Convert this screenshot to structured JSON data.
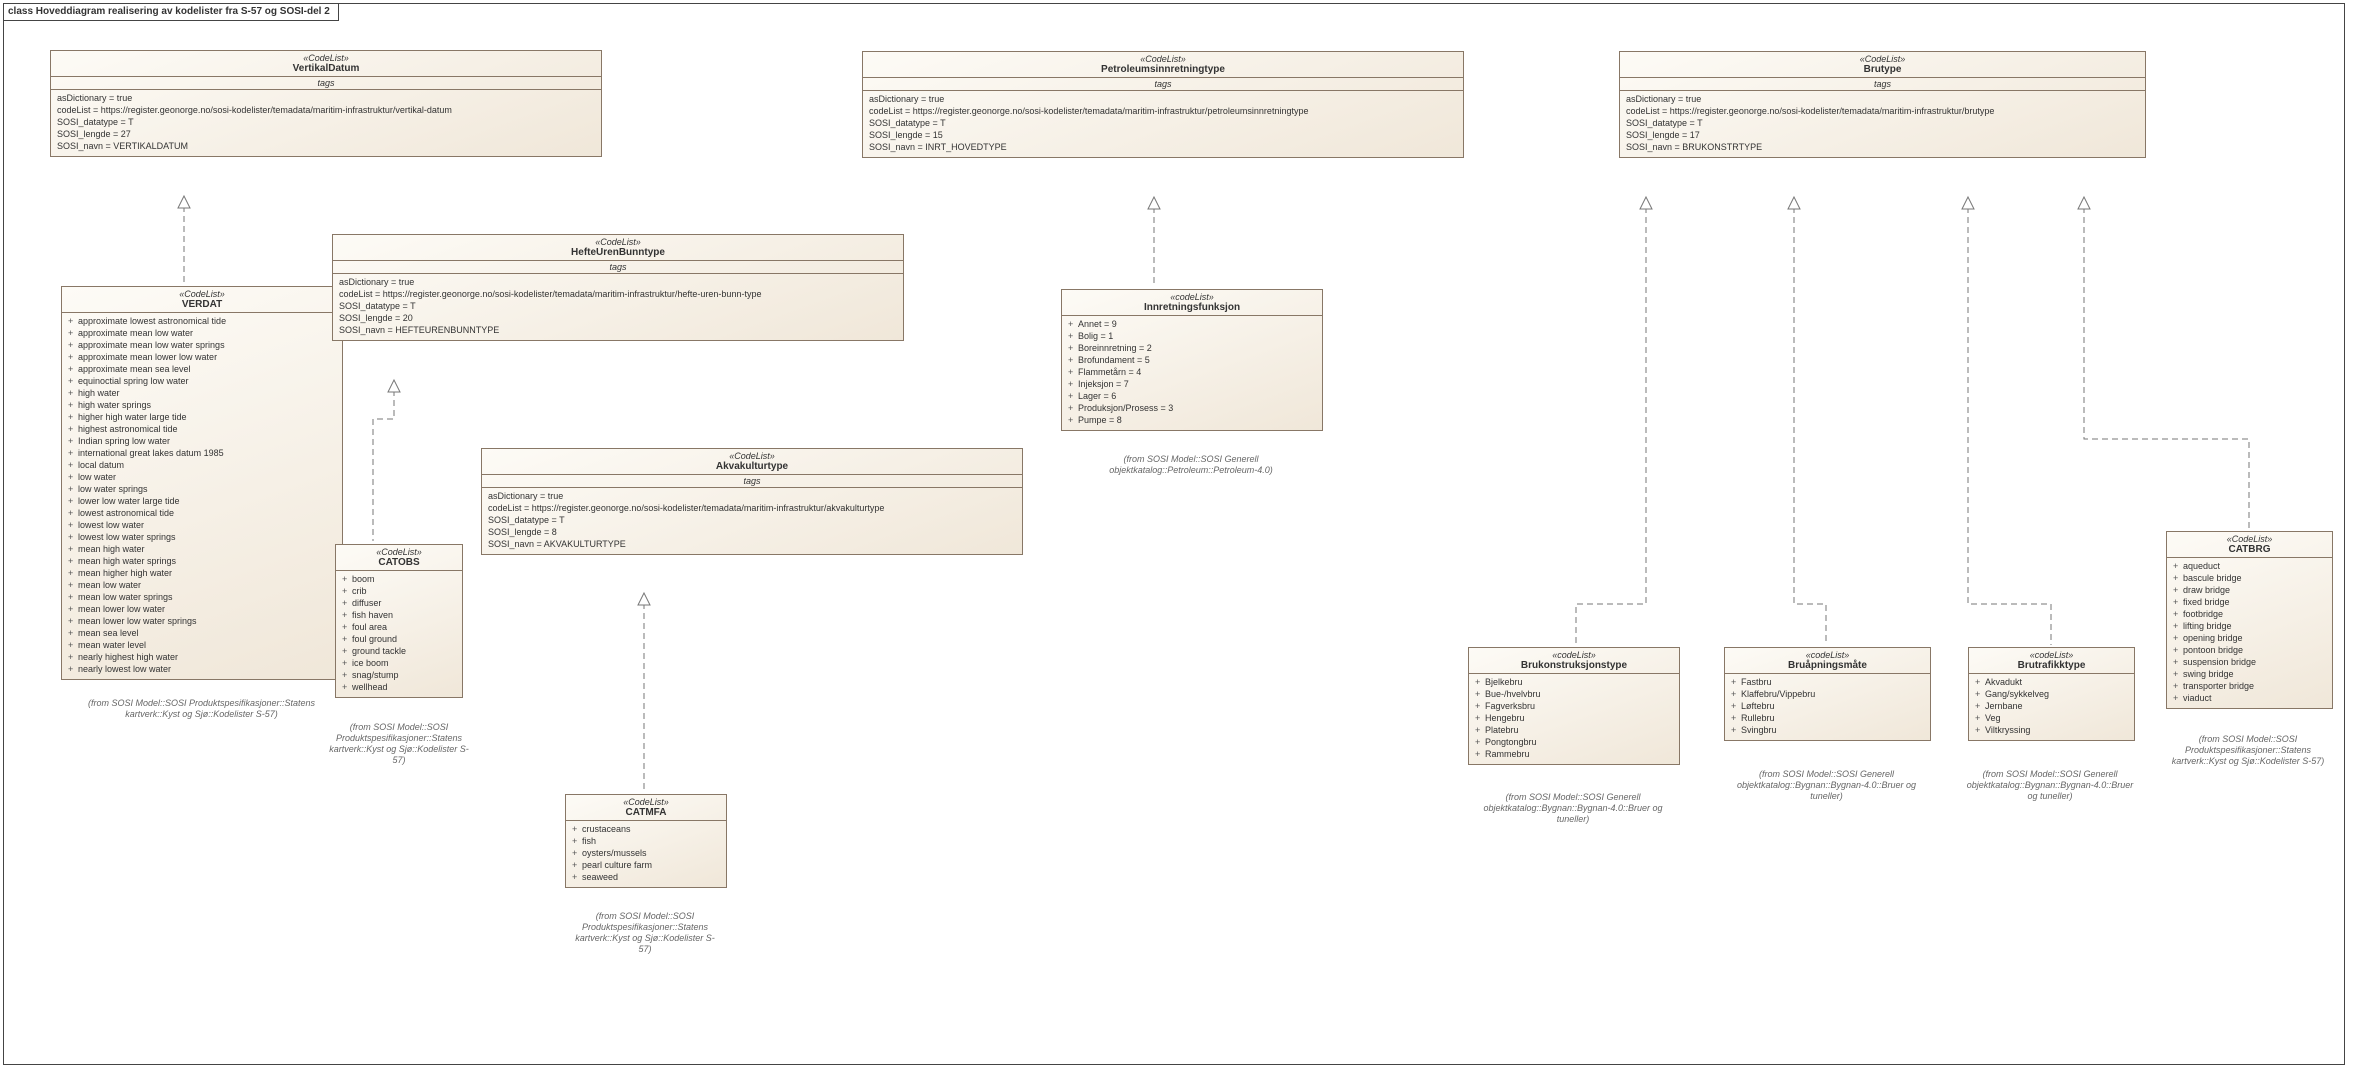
{
  "diagram_title": "class Hoveddiagram realisering av kodelister fra S-57 og SOSI-del 2",
  "vertikalDatum": {
    "stereo": "«CodeList»",
    "name": "VertikalDatum",
    "asDictionary": "asDictionary = true",
    "codeList": "codeList = https://register.geonorge.no/sosi-kodelister/temadata/maritim-infrastruktur/vertikal-datum",
    "datatype": "SOSI_datatype = T",
    "lengde": "SOSI_lengde = 27",
    "navn": "SOSI_navn = VERTIKALDATUM"
  },
  "verdat": {
    "stereo": "«CodeList»",
    "name": "VERDAT",
    "items": [
      "approximate lowest astronomical tide",
      "approximate mean low water",
      "approximate mean low water springs",
      "approximate mean lower low water",
      "approximate mean sea level",
      "equinoctial spring low water",
      "high water",
      "high water springs",
      "higher high water large tide",
      "highest astronomical tide",
      "Indian spring low water",
      "international great lakes datum 1985",
      "local datum",
      "low water",
      "low water springs",
      "lower low water large tide",
      "lowest astronomical tide",
      "lowest low water",
      "lowest low water springs",
      "mean high water",
      "mean high water springs",
      "mean higher high water",
      "mean low water",
      "mean low water springs",
      "mean lower low water",
      "mean lower low water springs",
      "mean sea level",
      "mean water level",
      "nearly highest high water",
      "nearly lowest low water"
    ],
    "note": "(from SOSI Model::SOSI Produktspesifikasjoner::Statens kartverk::Kyst og Sjø::Kodelister S-57)"
  },
  "hefteUrenBunn": {
    "stereo": "«CodeList»",
    "name": "HefteUrenBunntype",
    "asDictionary": "asDictionary = true",
    "codeList": "codeList = https://register.geonorge.no/sosi-kodelister/temadata/maritim-infrastruktur/hefte-uren-bunn-type",
    "datatype": "SOSI_datatype = T",
    "lengde": "SOSI_lengde = 20",
    "navn": "SOSI_navn = HEFTEURENBUNNTYPE"
  },
  "catobs": {
    "stereo": "«CodeList»",
    "name": "CATOBS",
    "items": [
      "boom",
      "crib",
      "diffuser",
      "fish haven",
      "foul area",
      "foul ground",
      "ground tackle",
      "ice boom",
      "snag/stump",
      "wellhead"
    ],
    "note": "(from SOSI Model::SOSI Produktspesifikasjoner::Statens kartverk::Kyst og Sjø::Kodelister S-57)"
  },
  "akvakultur": {
    "stereo": "«CodeList»",
    "name": "Akvakulturtype",
    "asDictionary": "asDictionary = true",
    "codeList": "codeList = https://register.geonorge.no/sosi-kodelister/temadata/maritim-infrastruktur/akvakulturtype",
    "datatype": "SOSI_datatype = T",
    "lengde": "SOSI_lengde = 8",
    "navn": "SOSI_navn = AKVAKULTURTYPE"
  },
  "catmfa": {
    "stereo": "«CodeList»",
    "name": "CATMFA",
    "items": [
      "crustaceans",
      "fish",
      "oysters/mussels",
      "pearl culture farm",
      "seaweed"
    ],
    "note": "(from SOSI Model::SOSI Produktspesifikasjoner::Statens kartverk::Kyst og Sjø::Kodelister S-57)"
  },
  "petroleum": {
    "stereo": "«CodeList»",
    "name": "Petroleumsinnretningtype",
    "asDictionary": "asDictionary = true",
    "codeList": "codeList = https://register.geonorge.no/sosi-kodelister/temadata/maritim-infrastruktur/petroleumsinnretningtype",
    "datatype": "SOSI_datatype = T",
    "lengde": "SOSI_lengde = 15",
    "navn": "SOSI_navn = INRT_HOVEDTYPE"
  },
  "innretning": {
    "stereo": "«codeList»",
    "name": "Innretningsfunksjon",
    "items": [
      "Annet = 9",
      "Bolig = 1",
      "Boreinnretning = 2",
      "Brofundament = 5",
      "Flammetårn = 4",
      "Injeksjon = 7",
      "Lager = 6",
      "Produksjon/Prosess = 3",
      "Pumpe = 8"
    ],
    "note": "(from SOSI Model::SOSI Generell objektkatalog::Petroleum::Petroleum-4.0)"
  },
  "brutype": {
    "stereo": "«CodeList»",
    "name": "Brutype",
    "asDictionary": "asDictionary = true",
    "codeList": "codeList = https://register.geonorge.no/sosi-kodelister/temadata/maritim-infrastruktur/brutype",
    "datatype": "SOSI_datatype = T",
    "lengde": "SOSI_lengde = 17",
    "navn": "SOSI_navn = BRUKONSTRTYPE"
  },
  "brukonstruksjon": {
    "stereo": "«codeList»",
    "name": "Brukonstruksjonstype",
    "items": [
      "Bjelkebru",
      "Bue-/hvelvbru",
      "Fagverksbru",
      "Hengebru",
      "Platebru",
      "Pongtongbru",
      "Rammebru"
    ],
    "note": "(from SOSI Model::SOSI Generell objektkatalog::Bygnan::Bygnan-4.0::Bruer og tuneller)"
  },
  "bruapning": {
    "stereo": "«codeList»",
    "name": "Bruåpningsmåte",
    "items": [
      "Fastbru",
      "Klaffebru/Vippebru",
      "Løftebru",
      "Rullebru",
      "Svingbru"
    ],
    "note": "(from SOSI Model::SOSI Generell objektkatalog::Bygnan::Bygnan-4.0::Bruer og tuneller)"
  },
  "brutrafikk": {
    "stereo": "«codeList»",
    "name": "Brutrafikktype",
    "items": [
      "Akvadukt",
      "Gang/sykkelveg",
      "Jernbane",
      "Veg",
      "Viltkryssing"
    ],
    "note": "(from SOSI Model::SOSI Generell objektkatalog::Bygnan::Bygnan-4.0::Bruer og tuneller)"
  },
  "catbrg": {
    "stereo": "«CodeList»",
    "name": "CATBRG",
    "items": [
      "aqueduct",
      "bascule bridge",
      "draw bridge",
      "fixed bridge",
      "footbridge",
      "lifting bridge",
      "opening bridge",
      "pontoon bridge",
      "suspension bridge",
      "swing bridge",
      "transporter bridge",
      "viaduct"
    ],
    "note": "(from SOSI Model::SOSI Produktspesifikasjoner::Statens kartverk::Kyst og Sjø::Kodelister S-57)"
  },
  "tagsLabel": "tags"
}
